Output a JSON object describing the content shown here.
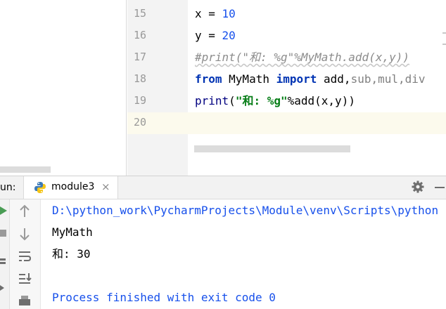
{
  "editor": {
    "lines": [
      {
        "number": "15",
        "tokens": [
          {
            "t": "x = ",
            "c": "plain"
          },
          {
            "t": "10",
            "c": "num"
          }
        ]
      },
      {
        "number": "16",
        "tokens": [
          {
            "t": "y = ",
            "c": "plain"
          },
          {
            "t": "20",
            "c": "num"
          }
        ]
      },
      {
        "number": "17",
        "tokens": [
          {
            "t": "#print(\"和: %g\"%MyMath.add(x,y))",
            "c": "cmt"
          }
        ]
      },
      {
        "number": "18",
        "tokens": [
          {
            "t": "from",
            "c": "kw"
          },
          {
            "t": " MyMath ",
            "c": "plain"
          },
          {
            "t": "import",
            "c": "kw"
          },
          {
            "t": " add,",
            "c": "plain"
          },
          {
            "t": "sub,mul,div",
            "c": "dim"
          }
        ]
      },
      {
        "number": "19",
        "tokens": [
          {
            "t": "print",
            "c": "bi"
          },
          {
            "t": "(",
            "c": "plain"
          },
          {
            "t": "\"和: %g\"",
            "c": "str"
          },
          {
            "t": "%add(x,y))",
            "c": "plain"
          }
        ]
      },
      {
        "number": "20",
        "tokens": []
      }
    ]
  },
  "run_panel": {
    "label": "un:",
    "tab_label": "module3",
    "tab_close": "×",
    "output": [
      {
        "text": "D:\\python_work\\PycharmProjects\\Module\\venv\\Scripts\\python",
        "style": "path"
      },
      {
        "text": "MyMath",
        "style": "plain"
      },
      {
        "text": "和: 30",
        "style": "plain"
      },
      {
        "text": "",
        "style": "plain"
      },
      {
        "text": "Process finished with exit code 0",
        "style": "exit"
      }
    ]
  },
  "colors": {
    "accent_blue": "#1750eb",
    "keyword": "#0033b3",
    "string": "#067d17",
    "run_green": "#499c54"
  },
  "icons": [
    "python-icon",
    "gear-icon",
    "minimize-icon",
    "up-arrow-icon",
    "down-arrow-icon",
    "soft-wrap-icon",
    "scroll-to-end-icon",
    "print-icon",
    "run-icon",
    "stop-icon"
  ]
}
